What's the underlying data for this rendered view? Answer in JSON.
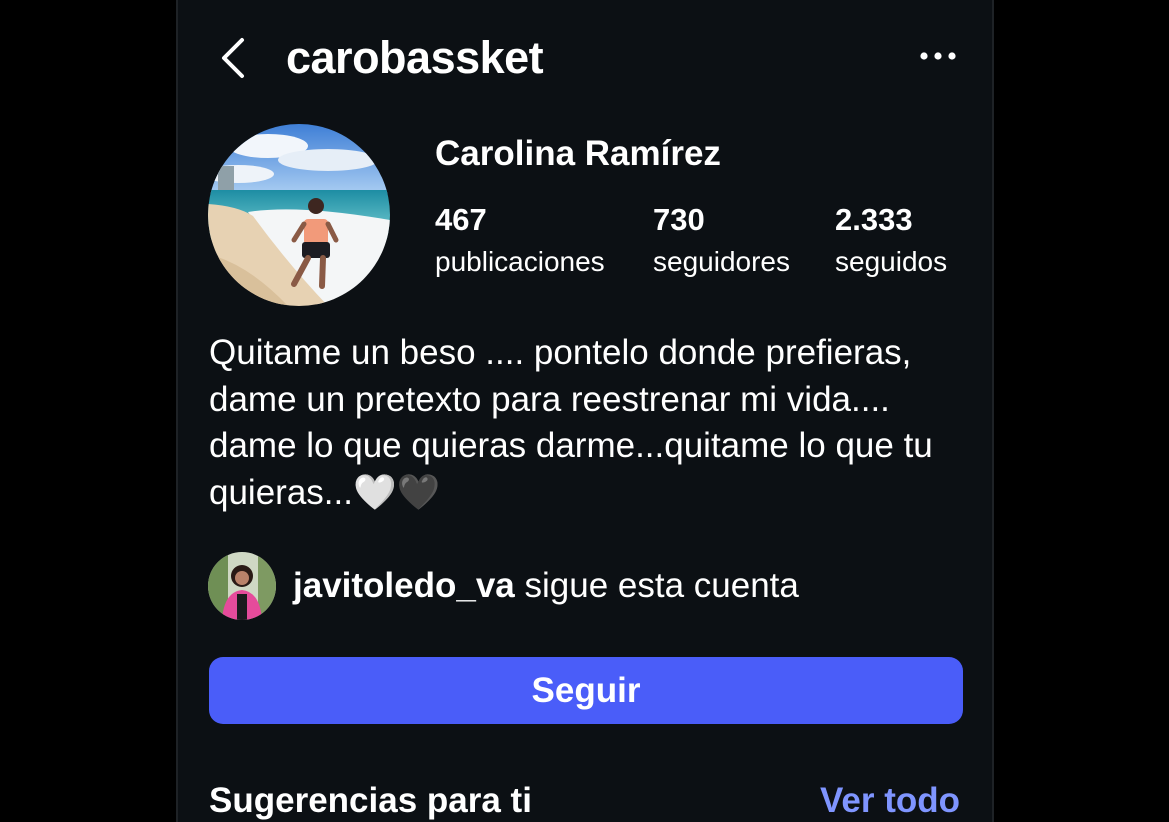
{
  "header": {
    "username": "carobassket",
    "back_icon": "chevron-left-icon",
    "more_icon": "more-horizontal-icon"
  },
  "profile": {
    "display_name": "Carolina Ramírez",
    "avatar_icon": "profile-photo-beach",
    "stats": [
      {
        "value": "467",
        "label": "publicaciones"
      },
      {
        "value": "730",
        "label": "seguidores"
      },
      {
        "value": "2.333",
        "label": "seguidos"
      }
    ],
    "bio": "Quitame un beso .... pontelo donde prefieras, dame un pretexto para reestrenar mi vida.... dame lo que quieras darme...quitame lo que tu quieras...🤍🖤"
  },
  "followed_by": {
    "username": "javitoledo_va",
    "text": " sigue esta cuenta"
  },
  "actions": {
    "follow_label": "Seguir"
  },
  "suggestions": {
    "title": "Sugerencias para ti",
    "see_all": "Ver todo"
  },
  "colors": {
    "background": "#0c1014",
    "follow_button": "#4a5df9",
    "link": "#7f95ff"
  }
}
